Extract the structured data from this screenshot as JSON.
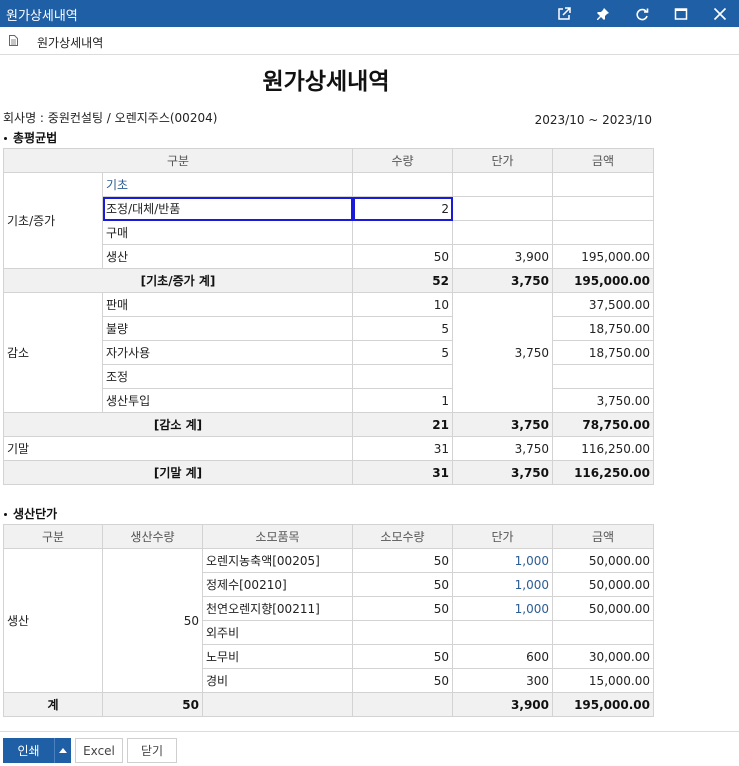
{
  "window": {
    "title": "원가상세내역",
    "buttons": [
      "external-link-icon",
      "pin-icon",
      "refresh-icon",
      "maximize-icon",
      "close-icon"
    ],
    "accent": "#1f5fa6"
  },
  "tab": {
    "label": "원가상세내역"
  },
  "report": {
    "title": "원가상세내역",
    "company": "회사명 : 중원컨설팅 / 오렌지주스(00204)",
    "period": "2023/10 ~ 2023/10"
  },
  "section1": {
    "title": "총평균법",
    "headers": [
      "구분",
      "수량",
      "단가",
      "금액"
    ],
    "group_basic": "기초/증가",
    "basic_rows": [
      {
        "sub": "기초",
        "qty": "",
        "price": "",
        "amount": ""
      },
      {
        "sub": "조정/대체/반품",
        "qty": "2",
        "price": "",
        "amount": ""
      },
      {
        "sub": "구매",
        "qty": "",
        "price": "",
        "amount": ""
      },
      {
        "sub": "생산",
        "qty": "50",
        "price": "3,900",
        "amount": "195,000.00"
      }
    ],
    "basic_sum": {
      "label": "[기초/증가 계]",
      "qty": "52",
      "price": "3,750",
      "amount": "195,000.00"
    },
    "group_decrease": "감소",
    "decrease_price": "3,750",
    "decrease_rows": [
      {
        "sub": "판매",
        "qty": "10",
        "amount": "37,500.00"
      },
      {
        "sub": "불량",
        "qty": "5",
        "amount": "18,750.00"
      },
      {
        "sub": "자가사용",
        "qty": "5",
        "amount": "18,750.00"
      },
      {
        "sub": "조정",
        "qty": "",
        "amount": ""
      },
      {
        "sub": "생산투입",
        "qty": "1",
        "amount": "3,750.00"
      }
    ],
    "decrease_sum": {
      "label": "[감소 계]",
      "qty": "21",
      "price": "3,750",
      "amount": "78,750.00"
    },
    "ending": {
      "label": "기말",
      "qty": "31",
      "price": "3,750",
      "amount": "116,250.00"
    },
    "ending_sum": {
      "label": "[기말 계]",
      "qty": "31",
      "price": "3,750",
      "amount": "116,250.00"
    }
  },
  "section2": {
    "title": "생산단가",
    "headers": [
      "구분",
      "생산수량",
      "소모품목",
      "소모수량",
      "단가",
      "금액"
    ],
    "group": "생산",
    "prod_qty": "50",
    "rows": [
      {
        "item": "오렌지농축액[00205]",
        "qty": "50",
        "price": "1,000",
        "amount": "50,000.00"
      },
      {
        "item": "정제수[00210]",
        "qty": "50",
        "price": "1,000",
        "amount": "50,000.00"
      },
      {
        "item": "천연오렌지향[00211]",
        "qty": "50",
        "price": "1,000",
        "amount": "50,000.00"
      },
      {
        "item": "외주비",
        "qty": "",
        "price": "",
        "amount": ""
      },
      {
        "item": "노무비",
        "qty": "50",
        "price": "600",
        "amount": "30,000.00"
      },
      {
        "item": "경비",
        "qty": "50",
        "price": "300",
        "amount": "15,000.00"
      }
    ],
    "total": {
      "label": "계",
      "prod_qty": "50",
      "price": "3,900",
      "amount": "195,000.00"
    }
  },
  "footer": {
    "print": "인쇄",
    "excel": "Excel",
    "close": "닫기"
  }
}
